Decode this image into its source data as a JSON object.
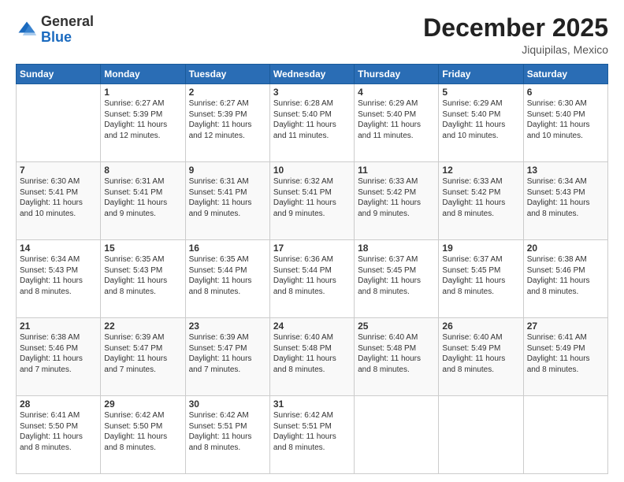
{
  "header": {
    "logo_general": "General",
    "logo_blue": "Blue",
    "month_title": "December 2025",
    "subtitle": "Jiquipilas, Mexico"
  },
  "days_of_week": [
    "Sunday",
    "Monday",
    "Tuesday",
    "Wednesday",
    "Thursday",
    "Friday",
    "Saturday"
  ],
  "weeks": [
    [
      {
        "day": "",
        "info": ""
      },
      {
        "day": "1",
        "info": "Sunrise: 6:27 AM\nSunset: 5:39 PM\nDaylight: 11 hours\nand 12 minutes."
      },
      {
        "day": "2",
        "info": "Sunrise: 6:27 AM\nSunset: 5:39 PM\nDaylight: 11 hours\nand 12 minutes."
      },
      {
        "day": "3",
        "info": "Sunrise: 6:28 AM\nSunset: 5:40 PM\nDaylight: 11 hours\nand 11 minutes."
      },
      {
        "day": "4",
        "info": "Sunrise: 6:29 AM\nSunset: 5:40 PM\nDaylight: 11 hours\nand 11 minutes."
      },
      {
        "day": "5",
        "info": "Sunrise: 6:29 AM\nSunset: 5:40 PM\nDaylight: 11 hours\nand 10 minutes."
      },
      {
        "day": "6",
        "info": "Sunrise: 6:30 AM\nSunset: 5:40 PM\nDaylight: 11 hours\nand 10 minutes."
      }
    ],
    [
      {
        "day": "7",
        "info": "Sunrise: 6:30 AM\nSunset: 5:41 PM\nDaylight: 11 hours\nand 10 minutes."
      },
      {
        "day": "8",
        "info": "Sunrise: 6:31 AM\nSunset: 5:41 PM\nDaylight: 11 hours\nand 9 minutes."
      },
      {
        "day": "9",
        "info": "Sunrise: 6:31 AM\nSunset: 5:41 PM\nDaylight: 11 hours\nand 9 minutes."
      },
      {
        "day": "10",
        "info": "Sunrise: 6:32 AM\nSunset: 5:41 PM\nDaylight: 11 hours\nand 9 minutes."
      },
      {
        "day": "11",
        "info": "Sunrise: 6:33 AM\nSunset: 5:42 PM\nDaylight: 11 hours\nand 9 minutes."
      },
      {
        "day": "12",
        "info": "Sunrise: 6:33 AM\nSunset: 5:42 PM\nDaylight: 11 hours\nand 8 minutes."
      },
      {
        "day": "13",
        "info": "Sunrise: 6:34 AM\nSunset: 5:43 PM\nDaylight: 11 hours\nand 8 minutes."
      }
    ],
    [
      {
        "day": "14",
        "info": "Sunrise: 6:34 AM\nSunset: 5:43 PM\nDaylight: 11 hours\nand 8 minutes."
      },
      {
        "day": "15",
        "info": "Sunrise: 6:35 AM\nSunset: 5:43 PM\nDaylight: 11 hours\nand 8 minutes."
      },
      {
        "day": "16",
        "info": "Sunrise: 6:35 AM\nSunset: 5:44 PM\nDaylight: 11 hours\nand 8 minutes."
      },
      {
        "day": "17",
        "info": "Sunrise: 6:36 AM\nSunset: 5:44 PM\nDaylight: 11 hours\nand 8 minutes."
      },
      {
        "day": "18",
        "info": "Sunrise: 6:37 AM\nSunset: 5:45 PM\nDaylight: 11 hours\nand 8 minutes."
      },
      {
        "day": "19",
        "info": "Sunrise: 6:37 AM\nSunset: 5:45 PM\nDaylight: 11 hours\nand 8 minutes."
      },
      {
        "day": "20",
        "info": "Sunrise: 6:38 AM\nSunset: 5:46 PM\nDaylight: 11 hours\nand 8 minutes."
      }
    ],
    [
      {
        "day": "21",
        "info": "Sunrise: 6:38 AM\nSunset: 5:46 PM\nDaylight: 11 hours\nand 7 minutes."
      },
      {
        "day": "22",
        "info": "Sunrise: 6:39 AM\nSunset: 5:47 PM\nDaylight: 11 hours\nand 7 minutes."
      },
      {
        "day": "23",
        "info": "Sunrise: 6:39 AM\nSunset: 5:47 PM\nDaylight: 11 hours\nand 7 minutes."
      },
      {
        "day": "24",
        "info": "Sunrise: 6:40 AM\nSunset: 5:48 PM\nDaylight: 11 hours\nand 8 minutes."
      },
      {
        "day": "25",
        "info": "Sunrise: 6:40 AM\nSunset: 5:48 PM\nDaylight: 11 hours\nand 8 minutes."
      },
      {
        "day": "26",
        "info": "Sunrise: 6:40 AM\nSunset: 5:49 PM\nDaylight: 11 hours\nand 8 minutes."
      },
      {
        "day": "27",
        "info": "Sunrise: 6:41 AM\nSunset: 5:49 PM\nDaylight: 11 hours\nand 8 minutes."
      }
    ],
    [
      {
        "day": "28",
        "info": "Sunrise: 6:41 AM\nSunset: 5:50 PM\nDaylight: 11 hours\nand 8 minutes."
      },
      {
        "day": "29",
        "info": "Sunrise: 6:42 AM\nSunset: 5:50 PM\nDaylight: 11 hours\nand 8 minutes."
      },
      {
        "day": "30",
        "info": "Sunrise: 6:42 AM\nSunset: 5:51 PM\nDaylight: 11 hours\nand 8 minutes."
      },
      {
        "day": "31",
        "info": "Sunrise: 6:42 AM\nSunset: 5:51 PM\nDaylight: 11 hours\nand 8 minutes."
      },
      {
        "day": "",
        "info": ""
      },
      {
        "day": "",
        "info": ""
      },
      {
        "day": "",
        "info": ""
      }
    ]
  ]
}
